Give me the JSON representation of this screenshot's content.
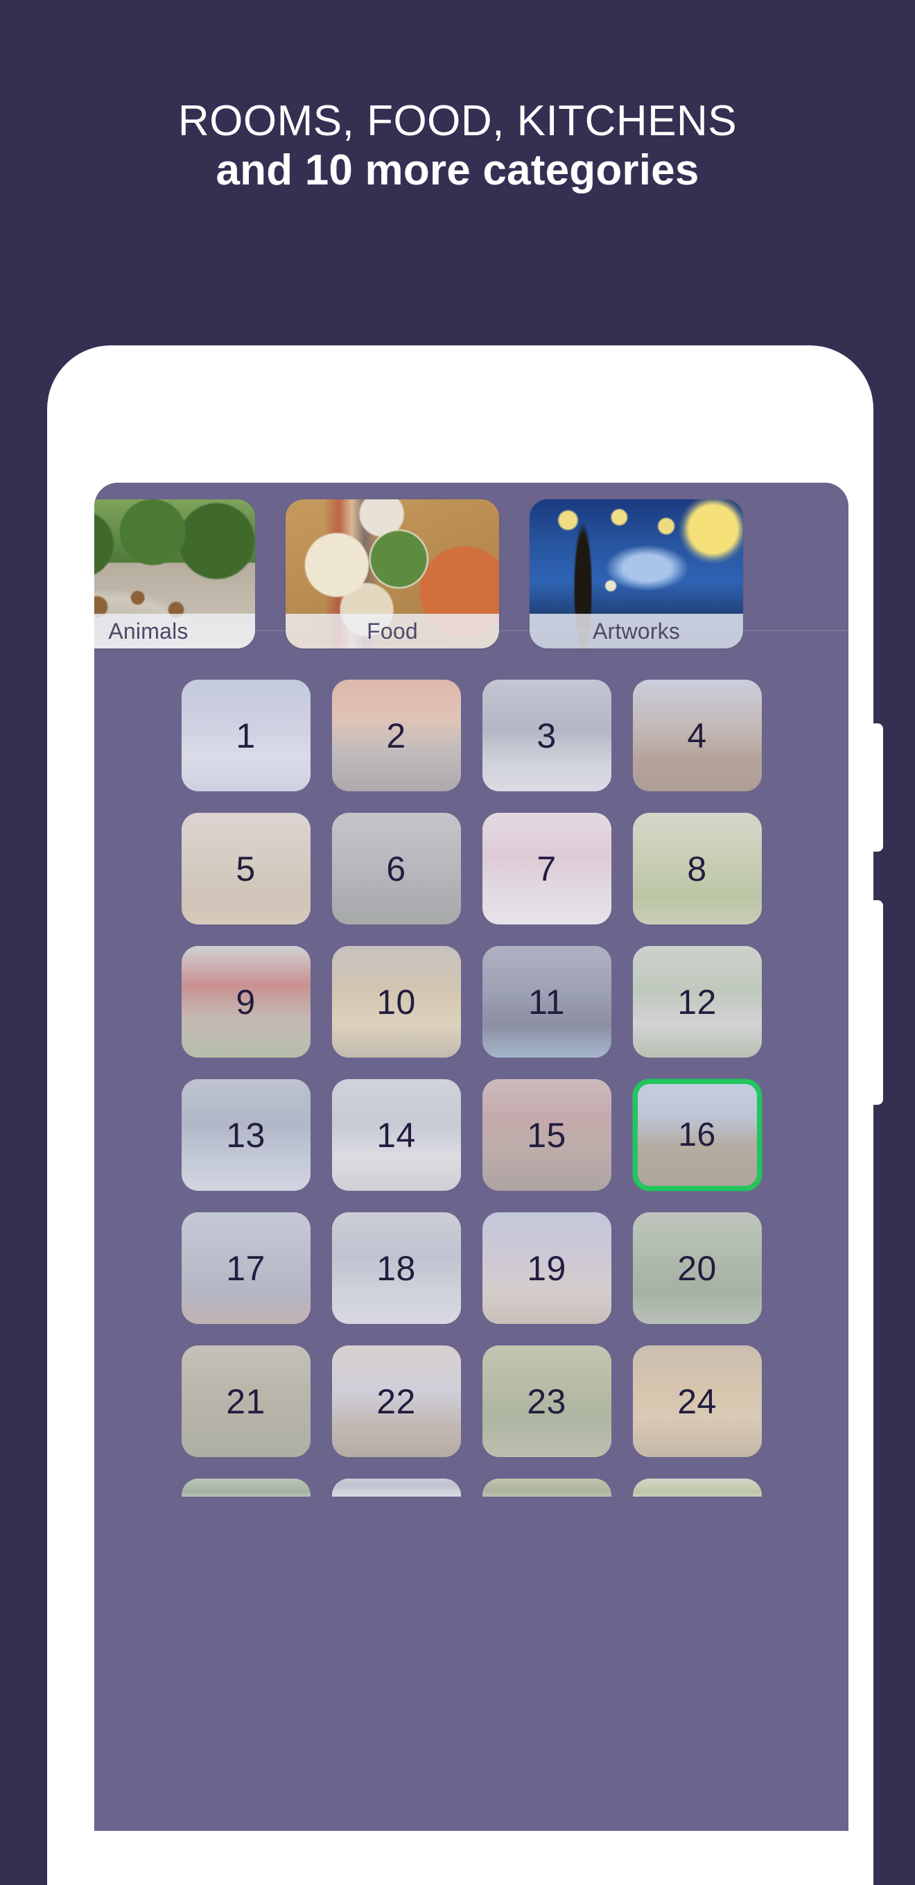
{
  "colors": {
    "page_background": "#353052",
    "phone_frame": "#ffffff",
    "screen_background": "#6b648c",
    "headline_text": "#ffffff",
    "tile_number": "#221d3f",
    "category_label": "#4d4766",
    "selection_border": "#22c55e"
  },
  "headline": {
    "line1": "ROOMS, FOOD, KITCHENS",
    "line2": "and 10 more categories"
  },
  "screen": {
    "categories": [
      {
        "label": "Animals",
        "art": "giraffes-photo",
        "selected": false
      },
      {
        "label": "Food",
        "art": "food-table-photo",
        "selected": false
      },
      {
        "label": "Artworks",
        "art": "starry-night-painting",
        "selected": false
      }
    ],
    "grid": {
      "columns": 4,
      "tiles": [
        {
          "number": "1",
          "art": "moon-over-lake",
          "selected": false
        },
        {
          "number": "2",
          "art": "moon-pines-eagle",
          "selected": false
        },
        {
          "number": "3",
          "art": "winged-figure-clouds",
          "selected": false
        },
        {
          "number": "4",
          "art": "desert-rock-arch",
          "selected": false
        },
        {
          "number": "5",
          "art": "birdcage-desert",
          "selected": false
        },
        {
          "number": "6",
          "art": "stone-ruins",
          "selected": false
        },
        {
          "number": "7",
          "art": "painted-face",
          "selected": false
        },
        {
          "number": "8",
          "art": "mushroom-grass",
          "selected": false
        },
        {
          "number": "9",
          "art": "red-mushrooms",
          "selected": false
        },
        {
          "number": "10",
          "art": "golden-clock-rays",
          "selected": false
        },
        {
          "number": "11",
          "art": "dark-knight-sky",
          "selected": false
        },
        {
          "number": "12",
          "art": "garden-window",
          "selected": false
        },
        {
          "number": "13",
          "art": "birds-over-water",
          "selected": false
        },
        {
          "number": "14",
          "art": "white-feathered-bird",
          "selected": false
        },
        {
          "number": "15",
          "art": "colorful-crowd",
          "selected": false
        },
        {
          "number": "16",
          "art": "highland-cow-field",
          "selected": true
        },
        {
          "number": "17",
          "art": "dome-bridge",
          "selected": false
        },
        {
          "number": "18",
          "art": "ship-stormy-sea",
          "selected": false
        },
        {
          "number": "19",
          "art": "obelisk-tower-desert",
          "selected": false
        },
        {
          "number": "20",
          "art": "green-ruins-forest",
          "selected": false
        },
        {
          "number": "21",
          "art": "ornate-mural",
          "selected": false
        },
        {
          "number": "22",
          "art": "rider-on-cliff",
          "selected": false
        },
        {
          "number": "23",
          "art": "bamboo-figure",
          "selected": false
        },
        {
          "number": "24",
          "art": "golden-waterfall",
          "selected": false
        }
      ],
      "partial_row_count": 4
    }
  }
}
